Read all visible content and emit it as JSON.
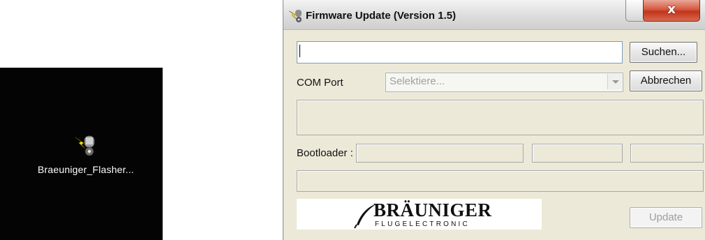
{
  "desktop": {
    "icon_label": "Braeuniger_Flasher...",
    "icon_name": "flasher-app-icon"
  },
  "window": {
    "title": "Firmware Update (Version 1.5)",
    "close_glyph": "x",
    "file_path_value": "",
    "search_button": "Suchen...",
    "com_port_label": "COM Port",
    "com_port_select": "Selektiere...",
    "cancel_button": "Abbrechen",
    "bootloader_label": "Bootloader :",
    "update_button": "Update",
    "logo": {
      "brand": "BRÄUNIGER",
      "subline": "FLUGELECTRONIC"
    }
  },
  "colors": {
    "desktop_bg": "#040404",
    "window_bg": "#ece9d8",
    "close_button": "#c0351c",
    "lightning": "#ffe000"
  }
}
